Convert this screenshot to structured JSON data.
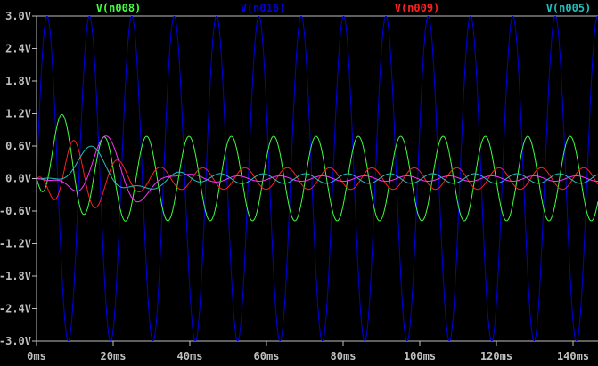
{
  "chart_data": {
    "type": "line",
    "title": "",
    "xlabel": "",
    "ylabel": "",
    "xlim": [
      0,
      146.5
    ],
    "ylim": [
      -3.0,
      3.0
    ],
    "x_unit": "ms",
    "grid": false,
    "legend_placement": "top",
    "x_ticks": [
      "0ms",
      "20ms",
      "40ms",
      "60ms",
      "80ms",
      "100ms",
      "120ms",
      "140ms"
    ],
    "x_tick_values": [
      0,
      20,
      40,
      60,
      80,
      100,
      120,
      140
    ],
    "y_ticks": [
      "3.0V",
      "2.4V",
      "1.8V",
      "1.2V",
      "0.6V",
      "0.0V",
      "-0.6V",
      "-1.2V",
      "-1.8V",
      "-2.4V",
      "-3.0V"
    ],
    "y_tick_values": [
      3.0,
      2.4,
      1.8,
      1.2,
      0.6,
      0.0,
      -0.6,
      -1.2,
      -1.8,
      -2.4,
      -3.0
    ],
    "period_ms": 11.05,
    "series": [
      {
        "name": "V(n016)",
        "color": "#0000e0",
        "label": "V(n016)",
        "steady_amp": 3.0,
        "steady_phase": 0.0,
        "onset": false,
        "transient": null
      },
      {
        "name": "V(n008)",
        "color": "#40ff40",
        "label": "V(n008)",
        "steady_amp": 0.78,
        "steady_phase": 0.35,
        "onset": true,
        "transient": {
          "amp": 0.5,
          "peak_ms": 6.0,
          "k": 3,
          "period_ms": 40
        }
      },
      {
        "name": "V(n009)",
        "color": "#ff2020",
        "label": "V(n009)",
        "steady_amp": 0.2,
        "steady_phase": 0.67,
        "onset": true,
        "transient": {
          "amp": 0.52,
          "peak_ms": 9.5,
          "k": 3,
          "period_ms": 12
        }
      },
      {
        "name": "V(n005)",
        "color": "#20c0c0",
        "label": "V(n005)",
        "steady_amp": 0.09,
        "steady_phase": 0.1,
        "onset": true,
        "transient": {
          "amp": 0.52,
          "peak_ms": 13.7,
          "k": 3,
          "period_ms": 28
        }
      },
      {
        "name": "unlabeled",
        "color": "#ff30ff",
        "label": null,
        "steady_amp": 0.05,
        "steady_phase": 0.5,
        "onset": true,
        "transient": {
          "amp": 0.75,
          "peak_ms": 17.9,
          "k": 6,
          "period_ms": 20
        }
      }
    ]
  }
}
